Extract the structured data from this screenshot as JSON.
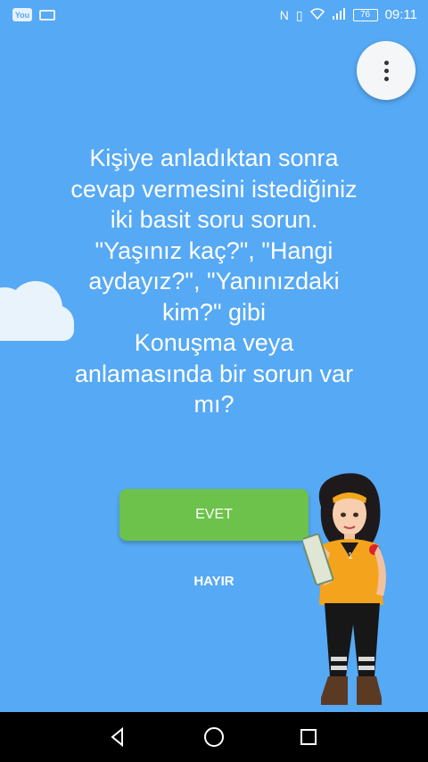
{
  "status_bar": {
    "left_icons": [
      "youtube-icon",
      "laptop-icon"
    ],
    "right_icons": [
      "nfc-icon",
      "vibrate-icon",
      "wifi-icon",
      "signal-icon"
    ],
    "battery_level": "76",
    "time": "09:11"
  },
  "menu": {
    "icon": "more-vert-icon"
  },
  "question": {
    "lines": [
      "Kişiye anladıktan sonra",
      "cevap vermesini istediğiniz",
      "iki basit soru sorun.",
      "\"Yaşınız kaç?\", \"Hangi",
      "aydayız?\", \"Yanınızdaki",
      "kim?\" gibi",
      "Konuşma veya",
      "anlamasında bir sorun var",
      "mı?"
    ]
  },
  "buttons": {
    "yes_label": "EVET",
    "no_label": "HAYIR"
  },
  "character": {
    "badge_number": "1"
  },
  "colors": {
    "background": "#56a9f4",
    "yes_button": "#6cc24a",
    "nav_bar": "#000000"
  },
  "nav_bar": {
    "icons": [
      "back-icon",
      "home-icon",
      "recents-icon"
    ]
  }
}
